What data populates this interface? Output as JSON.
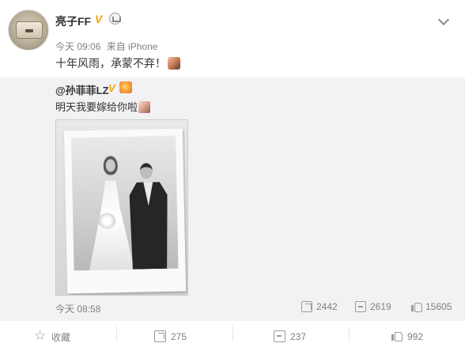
{
  "post": {
    "author": "亮子FF",
    "time": "今天 09:06",
    "source": "来自 iPhone",
    "content": "十年风雨，承蒙不弃！",
    "icons": {
      "verified": "verified-v-icon",
      "member": "crown-icon",
      "menu": "chevron-down-icon"
    }
  },
  "repost": {
    "author": "@孙菲菲LZ",
    "text": "明天我要嫁给你啦",
    "time": "今天 08:58",
    "share_count": "2442",
    "comment_count": "2619",
    "like_count": "15605"
  },
  "actions": {
    "favorite_label": "收藏",
    "share_count": "275",
    "comment_count": "237",
    "like_count": "992"
  },
  "colors": {
    "verified": "#f7a200",
    "meta_text": "#808080",
    "repost_bg": "#f2f2f5"
  }
}
